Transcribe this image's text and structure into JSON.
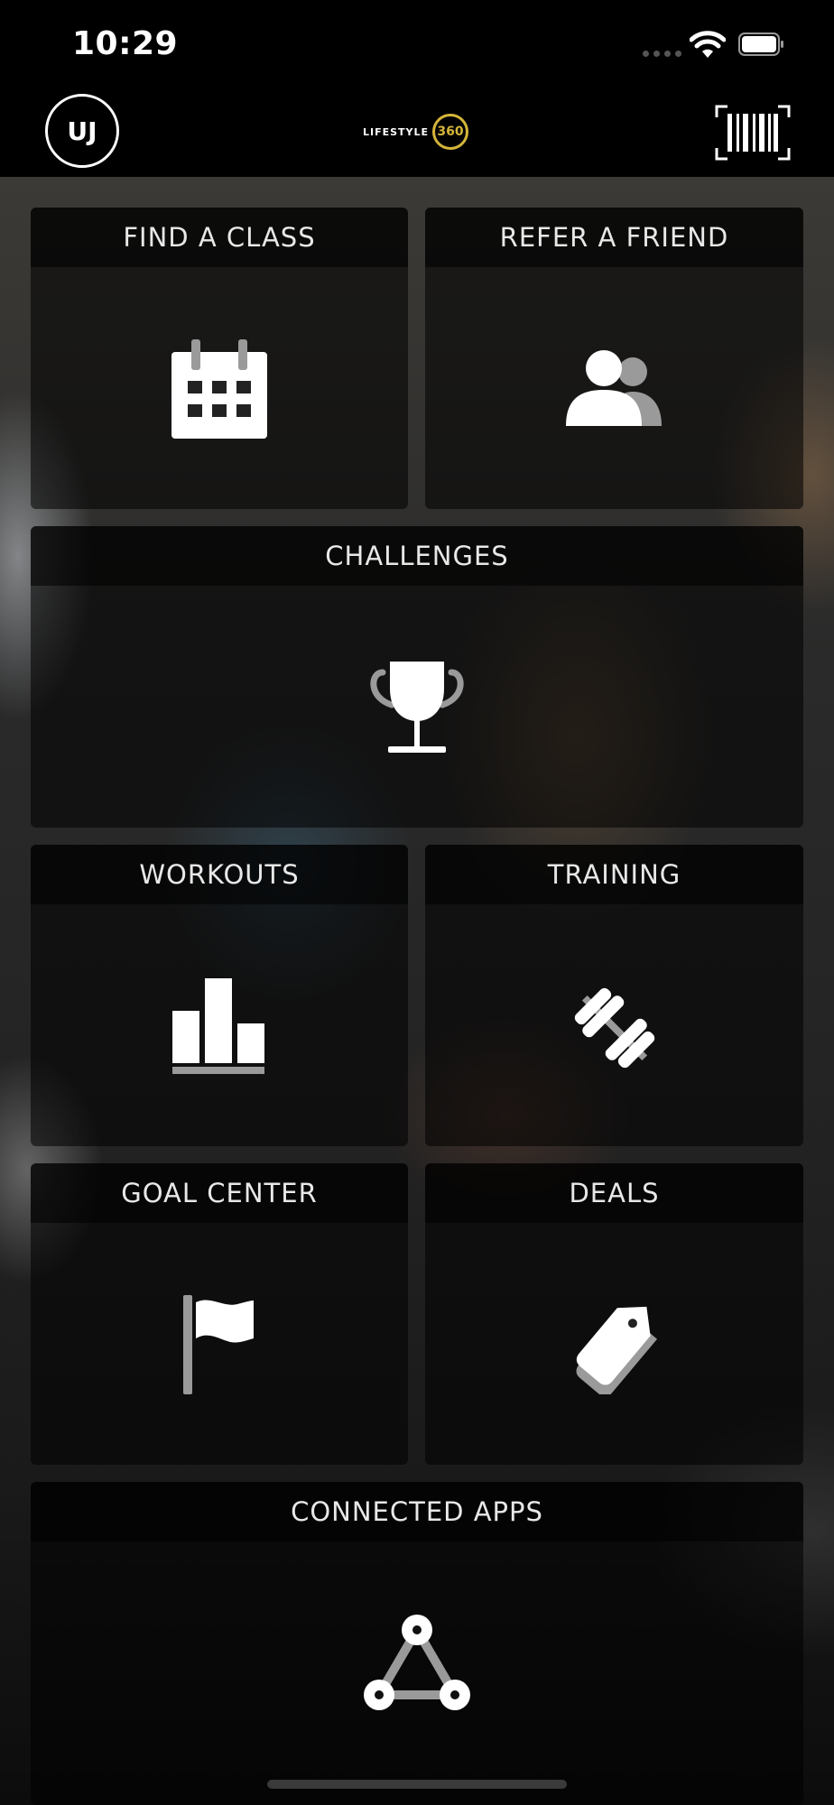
{
  "status_bar": {
    "time": "10:29"
  },
  "header": {
    "avatar_initials": "UJ",
    "logo_text": "LIFESTYLE",
    "logo_number": "360"
  },
  "tiles": [
    {
      "label": "FIND A CLASS",
      "icon": "calendar-icon"
    },
    {
      "label": "REFER A FRIEND",
      "icon": "people-icon"
    },
    {
      "label": "CHALLENGES",
      "icon": "trophy-icon"
    },
    {
      "label": "WORKOUTS",
      "icon": "bar-chart-icon"
    },
    {
      "label": "TRAINING",
      "icon": "dumbbell-icon"
    },
    {
      "label": "GOAL CENTER",
      "icon": "flag-icon"
    },
    {
      "label": "DEALS",
      "icon": "tag-icon"
    },
    {
      "label": "CONNECTED APPS",
      "icon": "network-icon"
    }
  ],
  "colors": {
    "accent_gold": "#d4b53a",
    "tile_head_bg": "#000000"
  }
}
